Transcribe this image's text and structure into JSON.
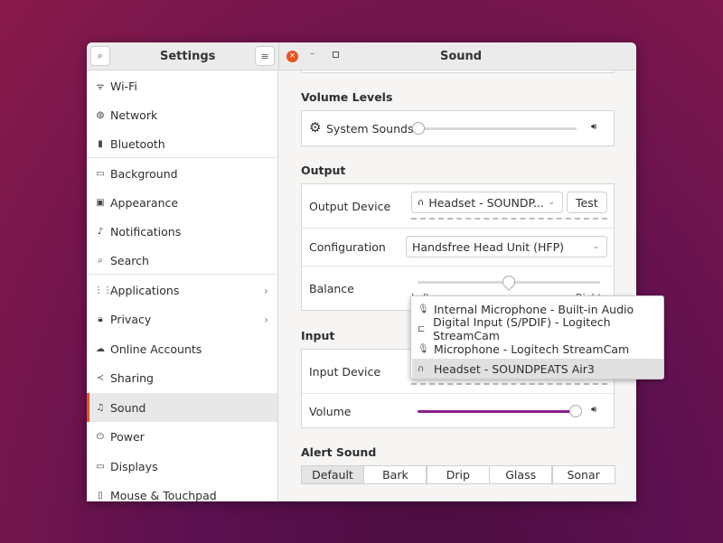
{
  "sidebar": {
    "title": "Settings",
    "items": [
      {
        "label": "Wi-Fi",
        "icon": "wifi-icon",
        "glyph": "ᯤ"
      },
      {
        "label": "Network",
        "icon": "network-icon",
        "glyph": "◍"
      },
      {
        "label": "Bluetooth",
        "icon": "bluetooth-icon",
        "glyph": "▮"
      },
      {
        "label": "Background",
        "icon": "background-icon",
        "glyph": "▭"
      },
      {
        "label": "Appearance",
        "icon": "appearance-icon",
        "glyph": "▣"
      },
      {
        "label": "Notifications",
        "icon": "bell-icon",
        "glyph": "♪"
      },
      {
        "label": "Search",
        "icon": "search-icon",
        "glyph": "⌕"
      },
      {
        "label": "Applications",
        "icon": "applications-icon",
        "glyph": "⋮⋮"
      },
      {
        "label": "Privacy",
        "icon": "lock-icon",
        "glyph": "🔒︎"
      },
      {
        "label": "Online Accounts",
        "icon": "cloud-icon",
        "glyph": "☁"
      },
      {
        "label": "Sharing",
        "icon": "share-icon",
        "glyph": "≺"
      },
      {
        "label": "Sound",
        "icon": "music-note-icon",
        "glyph": "♫"
      },
      {
        "label": "Power",
        "icon": "power-icon",
        "glyph": "⏻"
      },
      {
        "label": "Displays",
        "icon": "display-icon",
        "glyph": "▭"
      },
      {
        "label": "Mouse & Touchpad",
        "icon": "mouse-icon",
        "glyph": "▯"
      }
    ],
    "selected": "Sound"
  },
  "header": {
    "title": "Sound"
  },
  "volume_levels": {
    "label": "Volume Levels",
    "system_sounds": "System Sounds",
    "system_sounds_level": 0
  },
  "output": {
    "label": "Output",
    "device_label": "Output Device",
    "device_value": "Headset - SOUNDP...",
    "test": "Test",
    "config_label": "Configuration",
    "config_value": "Handsfree Head Unit (HFP)",
    "balance_label": "Balance",
    "balance_left": "Left",
    "balance_right": "Right",
    "balance_value": 0.5
  },
  "input": {
    "label": "Input",
    "device_label": "Input Device",
    "volume_label": "Volume",
    "volume_level": 1.0
  },
  "alert": {
    "label": "Alert Sound",
    "options": [
      "Default",
      "Bark",
      "Drip",
      "Glass",
      "Sonar"
    ],
    "selected": "Default"
  },
  "popup": {
    "items": [
      {
        "label": "Internal Microphone - Built-in Audio",
        "glyph": "🎙︎"
      },
      {
        "label": "Digital Input (S/PDIF) - Logitech StreamCam",
        "glyph": "⊏"
      },
      {
        "label": "Microphone - Logitech StreamCam",
        "glyph": "🎙︎"
      },
      {
        "label": "Headset - SOUNDPEATS Air3",
        "glyph": "∩"
      }
    ],
    "highlighted": "Headset - SOUNDPEATS Air3"
  },
  "colors": {
    "accent": "#e95420",
    "volume": "#8f1d8f"
  }
}
